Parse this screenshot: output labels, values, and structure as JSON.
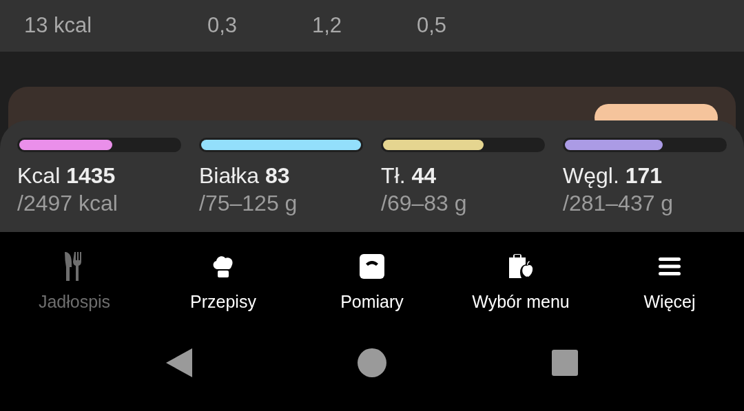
{
  "food_row": {
    "kcal": "13 kcal",
    "values": [
      "0,3",
      "1,2",
      "0,5"
    ]
  },
  "macros": [
    {
      "label": "Kcal",
      "value": "1435",
      "target": "/2497 kcal",
      "level": 0.58,
      "color": "#ea8fea"
    },
    {
      "label": "Białka",
      "value": "83",
      "target": "/75–125 g",
      "level": 1.0,
      "color": "#93dffb"
    },
    {
      "label": "Tł.",
      "value": "44",
      "target": "/69–83 g",
      "level": 0.63,
      "color": "#e5d590"
    },
    {
      "label": "Węgl.",
      "value": "171",
      "target": "/281–437 g",
      "level": 0.61,
      "color": "#ab9be5"
    }
  ],
  "nav": [
    {
      "label": "Jadłospis",
      "kind": "cutlery",
      "selected": true
    },
    {
      "label": "Przepisy",
      "kind": "chef",
      "selected": false
    },
    {
      "label": "Pomiary",
      "kind": "scale",
      "selected": false
    },
    {
      "label": "Wybór menu",
      "kind": "clipboard",
      "selected": false
    },
    {
      "label": "Więcej",
      "kind": "menu",
      "selected": false
    }
  ]
}
